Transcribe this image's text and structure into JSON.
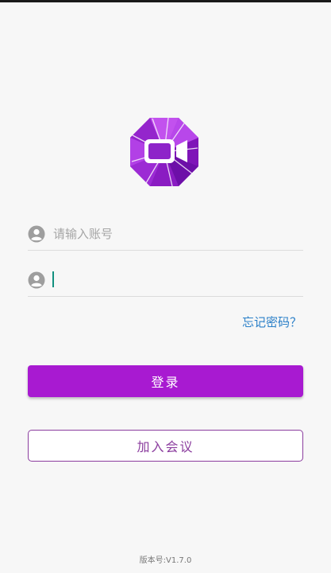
{
  "login_form": {
    "username": {
      "placeholder": "请输入账号",
      "value": "",
      "icon": "user-icon"
    },
    "password": {
      "placeholder": "",
      "value": "",
      "icon": "user-icon",
      "focused": true
    },
    "forgot_password_label": "忘记密码？",
    "login_button_label": "登录",
    "join_meeting_button_label": "加入会议"
  },
  "footer": {
    "version_label": "版本号:V1.7.0"
  },
  "colors": {
    "brand_purple": "#a81ad1",
    "outline_purple": "#8b3d9e",
    "link_blue": "#2a7fc8",
    "logo_dark": "#6a0fa2",
    "logo_light": "#b03de6"
  }
}
